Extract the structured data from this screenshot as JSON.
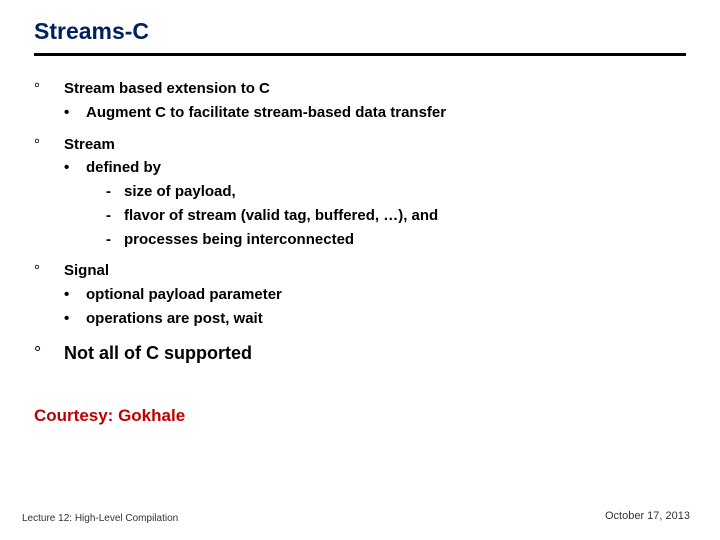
{
  "title": "Streams-C",
  "bullets": {
    "b1": {
      "head": "Stream based extension to C",
      "sub1": "Augment C to facilitate stream-based data transfer"
    },
    "b2": {
      "head": "Stream",
      "sub1": "defined by",
      "d1": "size of payload,",
      "d2": "flavor of stream (valid tag, buffered, …), and",
      "d3": "processes being interconnected"
    },
    "b3": {
      "head": "Signal",
      "sub1": "optional payload parameter",
      "sub2": "operations are post, wait"
    },
    "b4": {
      "head": "Not all of C supported"
    }
  },
  "courtesy": "Courtesy: Gokhale",
  "footer_left": "Lecture 12: High-Level Compilation",
  "footer_right": "October 17, 2013",
  "marks": {
    "deg": "°",
    "dot": "•",
    "dash": "-"
  }
}
